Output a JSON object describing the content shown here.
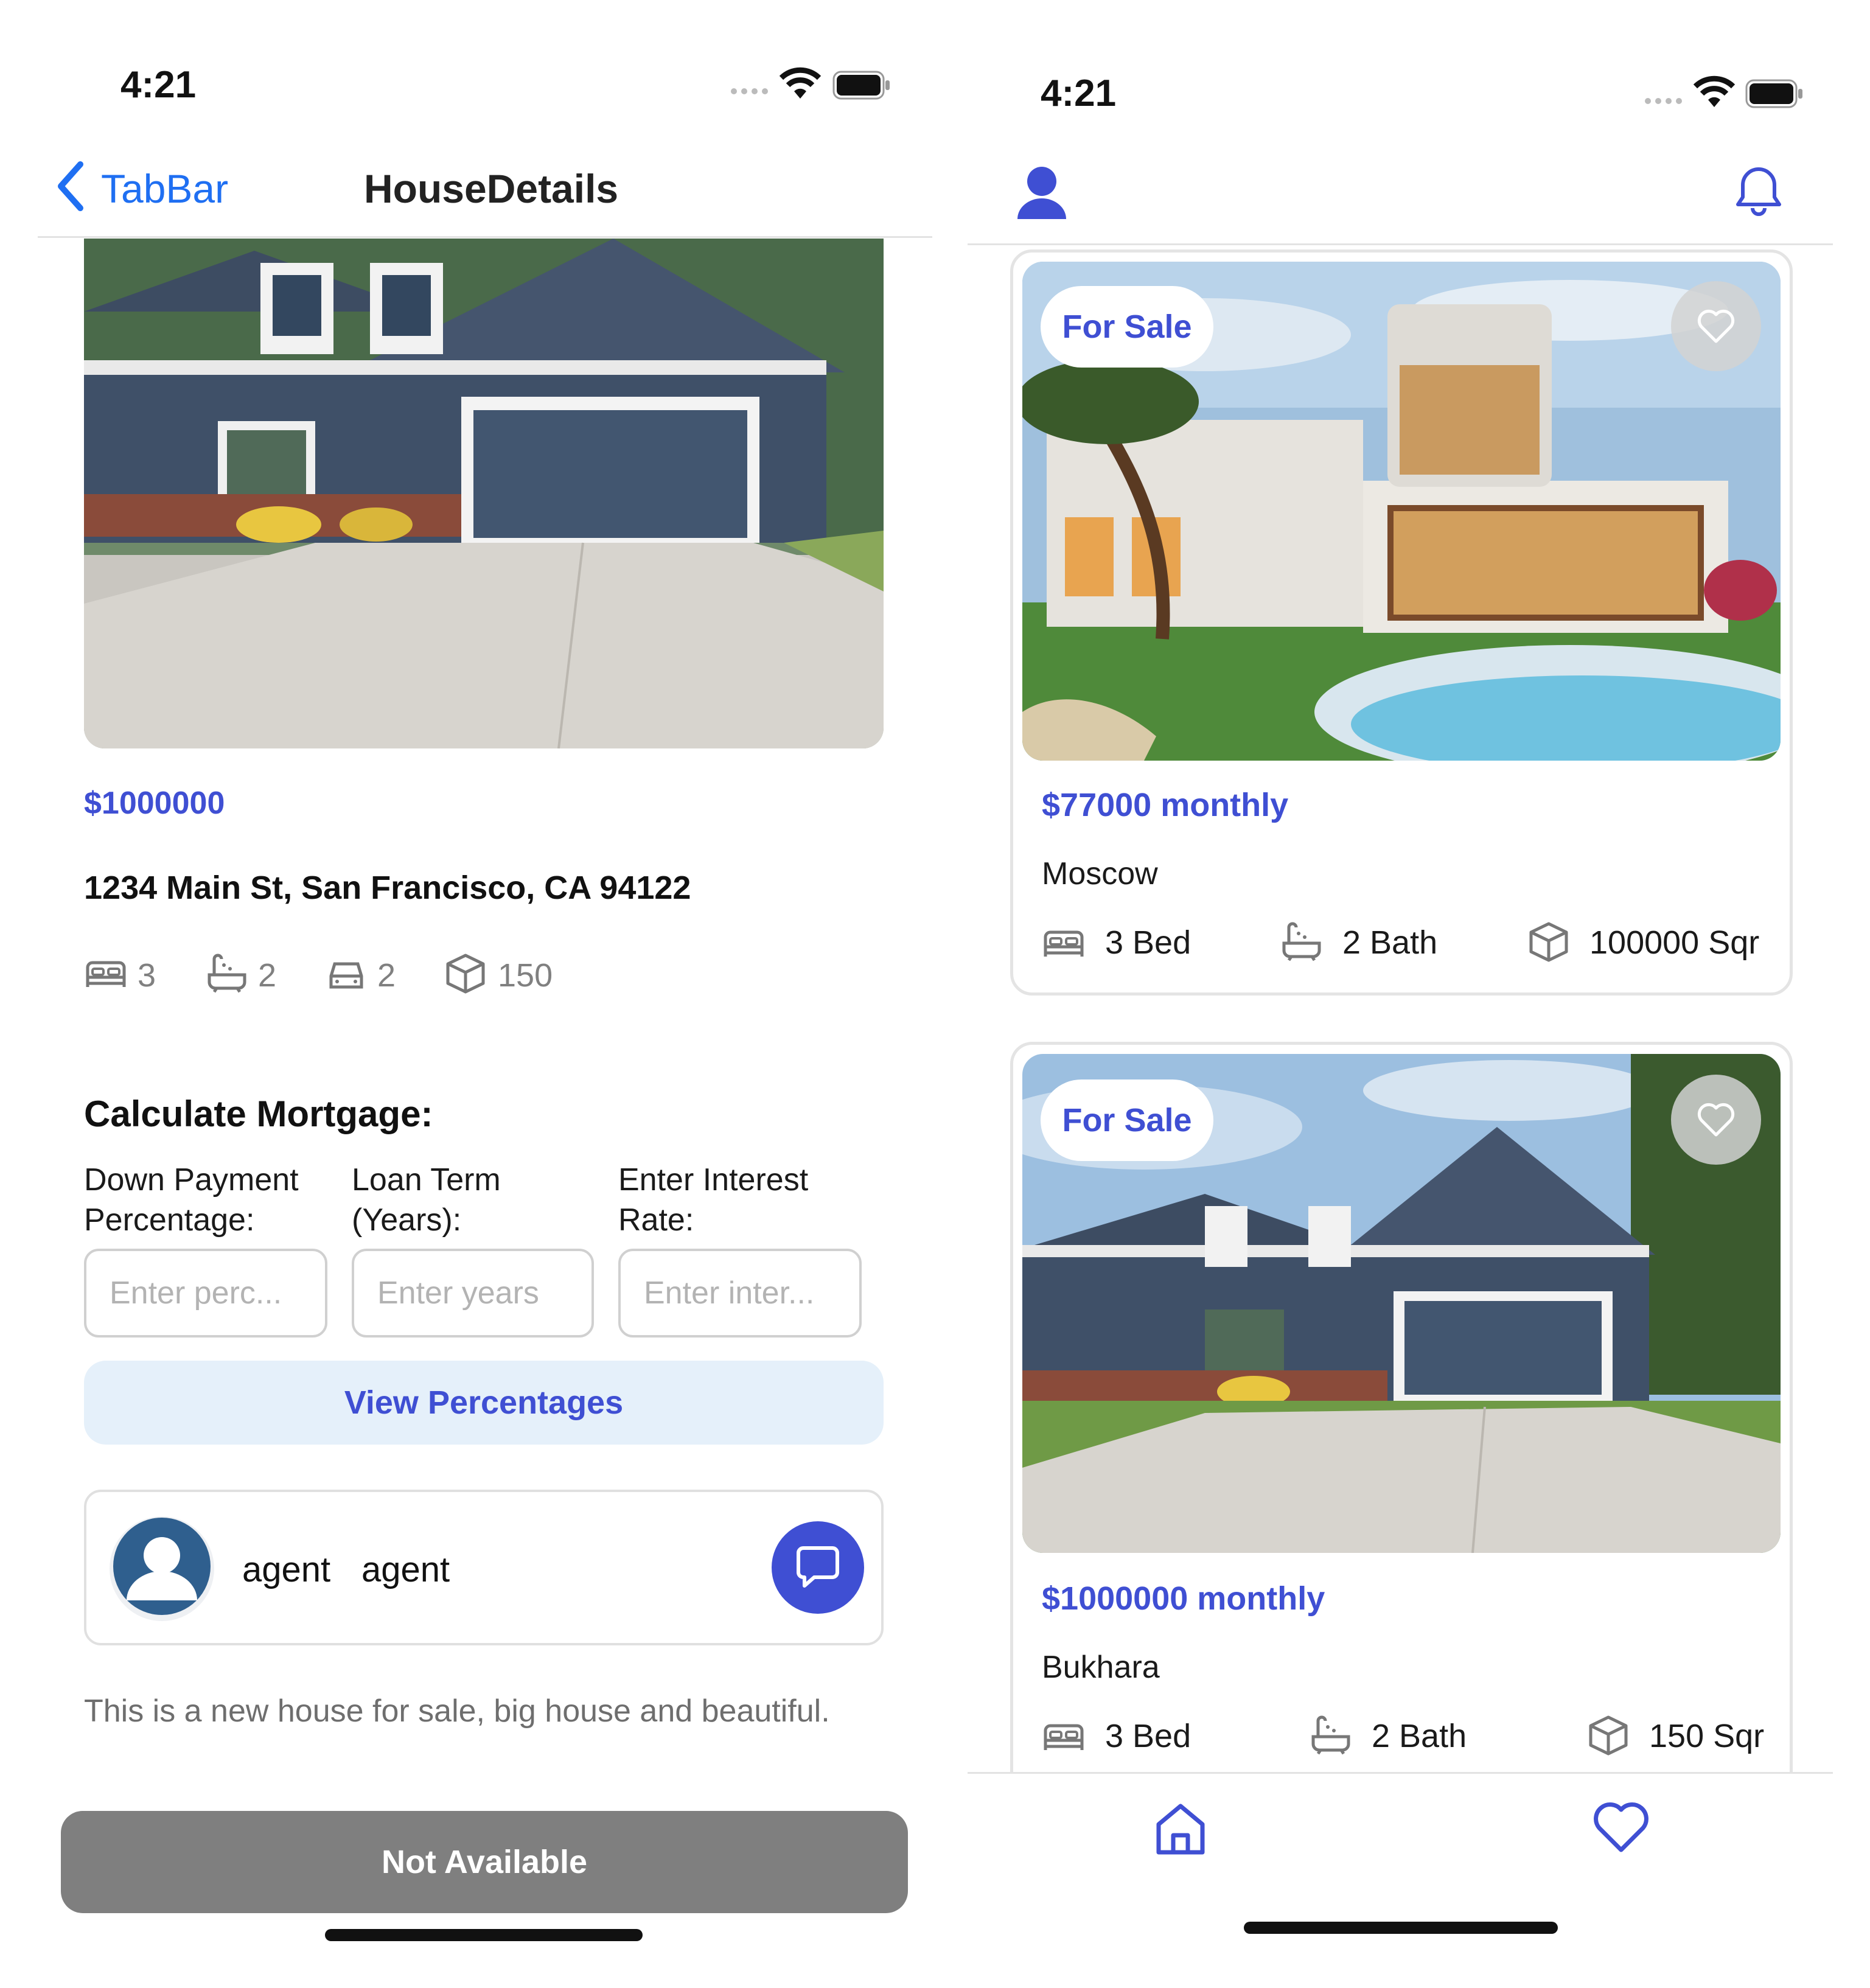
{
  "left": {
    "status_time": "4:21",
    "nav": {
      "back_label": "TabBar",
      "title": "HouseDetails"
    },
    "price": "$1000000",
    "address": "1234 Main St, San Francisco, CA 94122",
    "features": {
      "beds": "3",
      "baths": "2",
      "garage": "2",
      "area": "150"
    },
    "mortgage": {
      "heading": "Calculate Mortgage:",
      "fields": [
        {
          "label": "Down Payment\nPercentage:",
          "placeholder": "Enter perc..."
        },
        {
          "label": "Loan Term\n(Years):",
          "placeholder": "Enter years"
        },
        {
          "label": "Enter Interest\nRate:",
          "placeholder": "Enter inter..."
        }
      ],
      "button_label": "View Percentages"
    },
    "agent": {
      "first_name": "agent",
      "last_name": "agent"
    },
    "description": "This is a new house for sale, big house and beautiful.",
    "action_button": "Not Available"
  },
  "right": {
    "status_time": "4:21",
    "listings": [
      {
        "badge": "For Sale",
        "price": "$77000 monthly",
        "city": "Moscow",
        "beds": "3 Bed",
        "baths": "2 Bath",
        "area": "100000 Sqr"
      },
      {
        "badge": "For Sale",
        "price": "$1000000 monthly",
        "city": "Bukhara",
        "beds": "3 Bed",
        "baths": "2 Bath",
        "area": "150 Sqr"
      }
    ]
  },
  "colors": {
    "accent": "#3f4fd3",
    "ios_blue": "#1f6ff2",
    "disabled": "#7f7f7f",
    "light_blue": "#e5f0fa"
  },
  "icons": [
    "back-chevron-icon",
    "bed-icon",
    "bath-icon",
    "car-icon",
    "cube-icon",
    "chat-icon",
    "user-icon",
    "bell-icon",
    "heart-icon",
    "home-icon",
    "wifi-icon",
    "battery-icon",
    "signal-icon"
  ]
}
